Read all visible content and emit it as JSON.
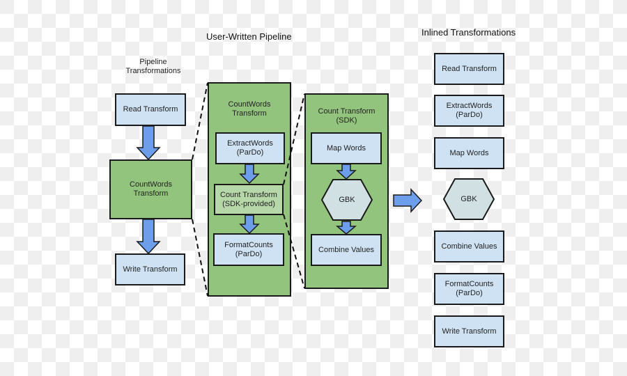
{
  "headings": {
    "pipeline_transformations": "Pipeline\nTransformations",
    "user_written_pipeline": "User-Written Pipeline",
    "inlined_transformations": "Inlined Transformations"
  },
  "left_column": {
    "read": "Read Transform",
    "countwords": "CountWords\nTransform",
    "write": "Write Transform"
  },
  "countwords_container": {
    "title": "CountWords\nTransform",
    "extractwords": "ExtractWords\n(ParDo)",
    "count_transform": "Count Transform\n(SDK-provided)",
    "formatcounts": "FormatCounts\n(ParDo)"
  },
  "count_container": {
    "title": "Count Transform\n(SDK)",
    "map_words": "Map Words",
    "gbk": "GBK",
    "combine_values": "Combine Values"
  },
  "inlined": {
    "read": "Read Transform",
    "extractwords": "ExtractWords\n(ParDo)",
    "map_words": "Map Words",
    "gbk": "GBK",
    "combine_values": "Combine Values",
    "formatcounts": "FormatCounts\n(ParDo)",
    "write": "Write Transform"
  },
  "colors": {
    "transform_box": "#cfe2f3",
    "composite_box": "#93c47d",
    "sdk_box": "#b6d7a8",
    "gbk": "#d0e0e3",
    "arrow": "#6d9eeb"
  }
}
